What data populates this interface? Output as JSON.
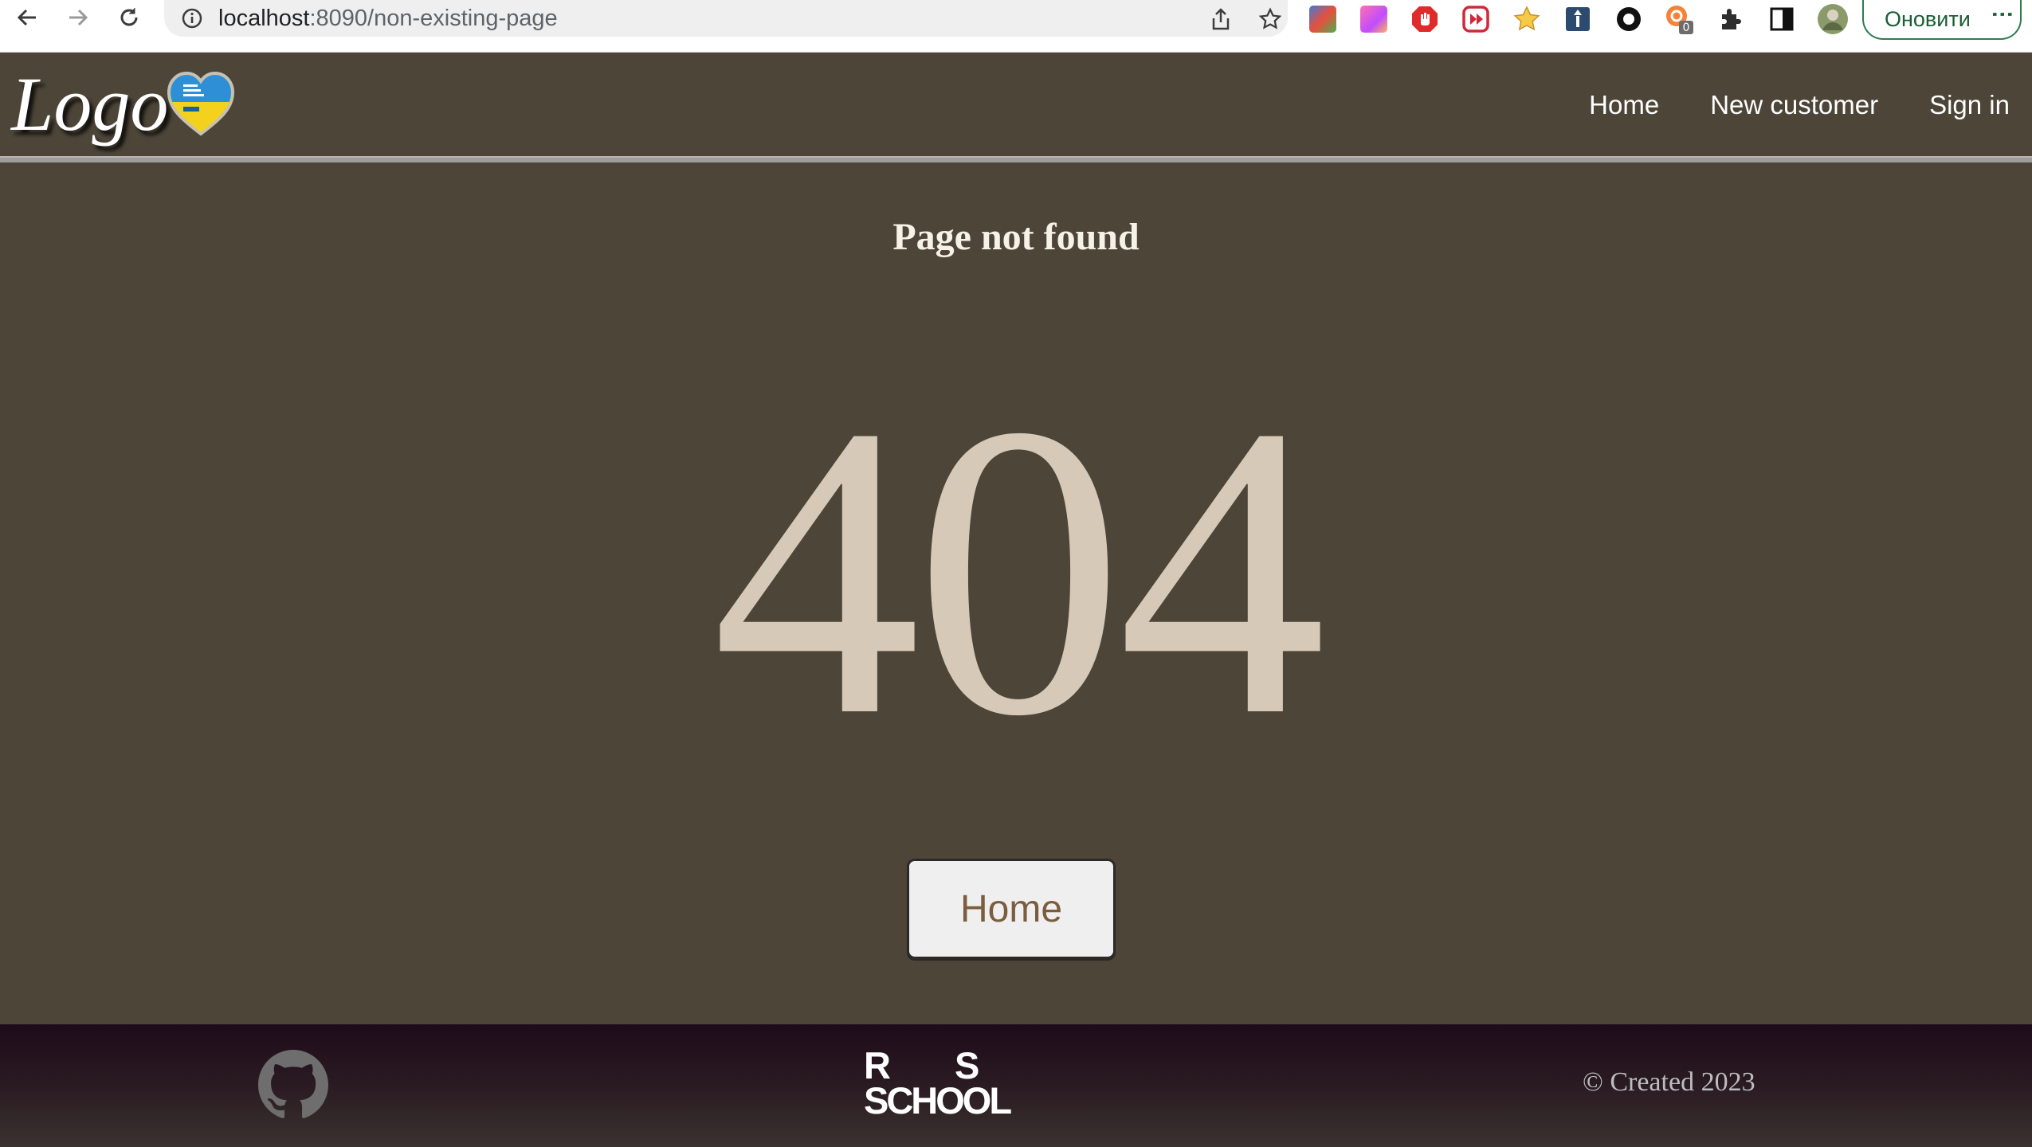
{
  "browser": {
    "url_host": "localhost",
    "url_path": ":8090/non-existing-page",
    "update_label": "Оновити",
    "extension_badge": "0",
    "icons": [
      "back-arrow-icon",
      "forward-arrow-icon",
      "reload-icon",
      "site-info-icon",
      "share-icon",
      "bookmark-star-icon",
      "extensions-puzzle-icon",
      "side-panel-icon",
      "profile-avatar",
      "menu-dots-icon"
    ]
  },
  "header": {
    "logo_text": "Logo",
    "logo_badge": "We stand together with Ukraine heart",
    "nav": [
      {
        "label": "Home"
      },
      {
        "label": "New customer"
      },
      {
        "label": "Sign in"
      }
    ]
  },
  "main": {
    "title": "Page not found",
    "code": "404",
    "home_button": "Home"
  },
  "footer": {
    "rs_line1_a": "R",
    "rs_line1_b": "S",
    "rs_line2": "SCHOOL",
    "copyright_symbol": "©",
    "copyright_text": "Created 2023"
  },
  "colors": {
    "page_bg": "#4c4538",
    "code_color": "#d6c9b8",
    "button_text": "#7a5d3f",
    "footer_top": "#1e0b1a"
  }
}
